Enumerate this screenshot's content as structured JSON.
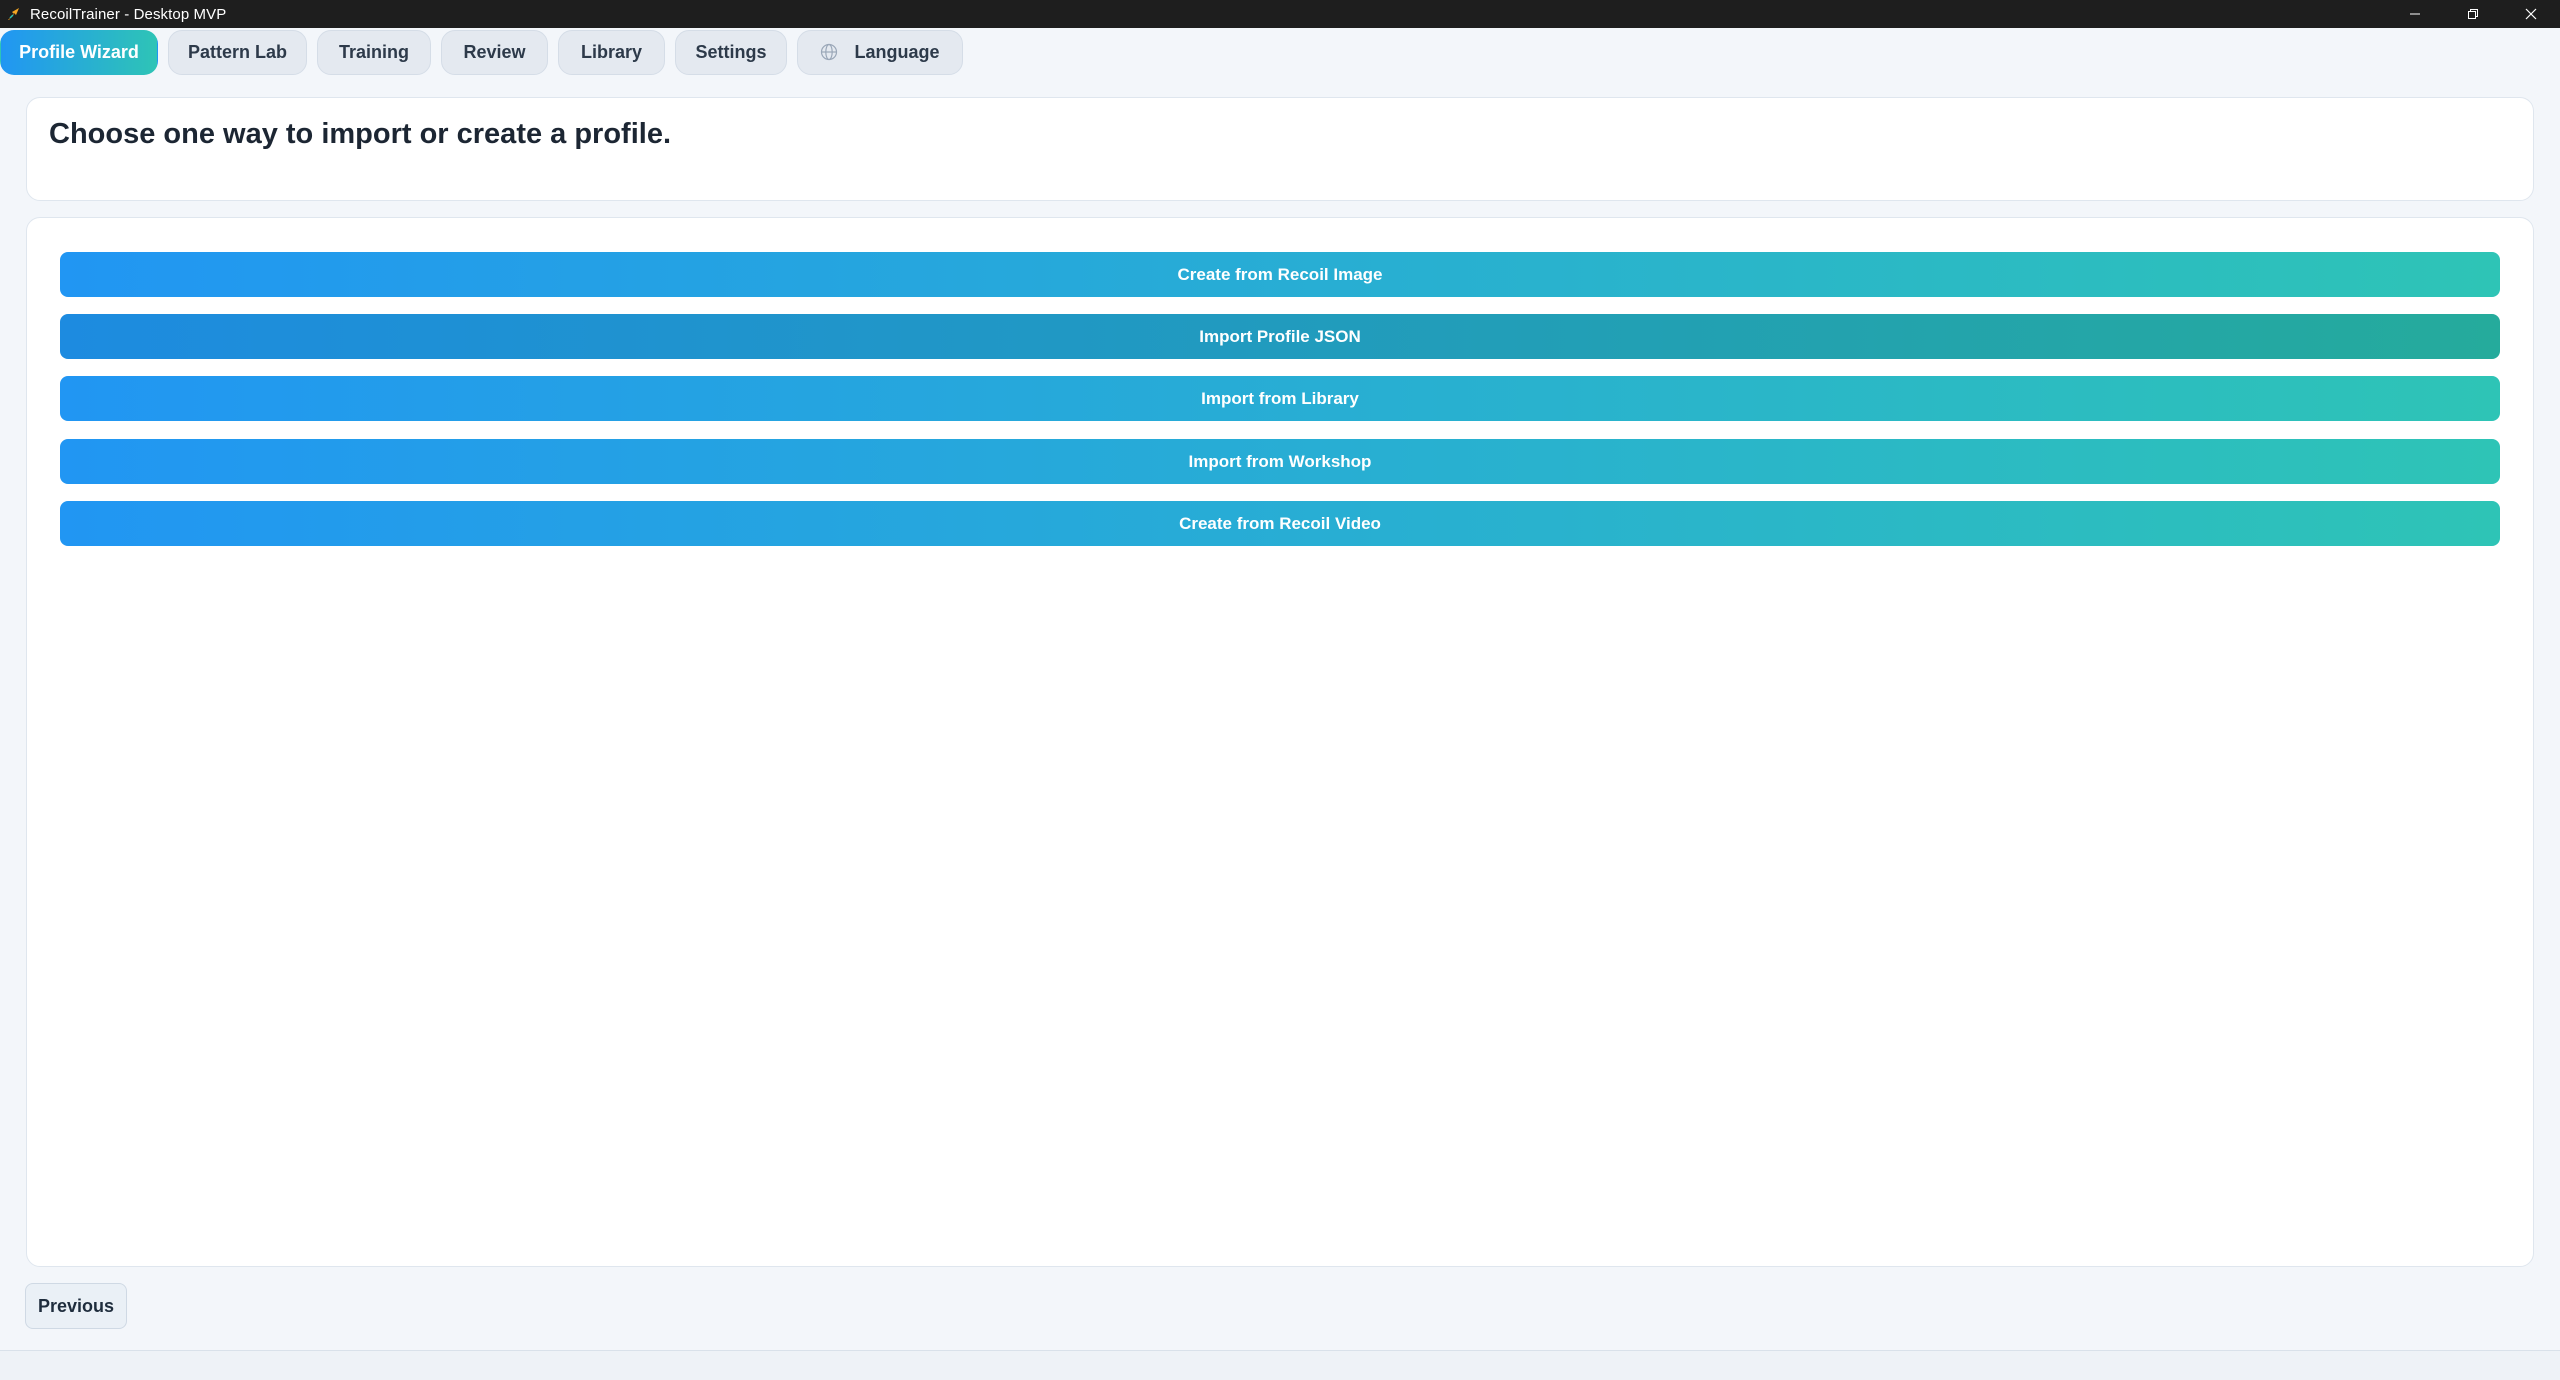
{
  "window": {
    "title": "RecoilTrainer - Desktop MVP",
    "icon": "app-logo-icon",
    "controls": [
      "minimize-icon",
      "restore-icon",
      "close-icon"
    ]
  },
  "tabs": {
    "profile_wizard": "Profile Wizard",
    "pattern_lab": "Pattern Lab",
    "training": "Training",
    "review": "Review",
    "library": "Library",
    "settings": "Settings",
    "language": "Language",
    "language_icon": "globe-icon"
  },
  "header": {
    "title": "Choose one way to import or create a profile."
  },
  "options": [
    {
      "label": "Create from Recoil Image"
    },
    {
      "label": "Import Profile JSON"
    },
    {
      "label": "Import from Library"
    },
    {
      "label": "Import from Workshop"
    },
    {
      "label": "Create from Recoil Video"
    }
  ],
  "footer": {
    "previous_label": "Previous"
  },
  "colors": {
    "accent_start": "#2196f3",
    "accent_end": "#2ec4b6",
    "titlebar": "#1e1e1e",
    "background": "#f3f6fa"
  }
}
